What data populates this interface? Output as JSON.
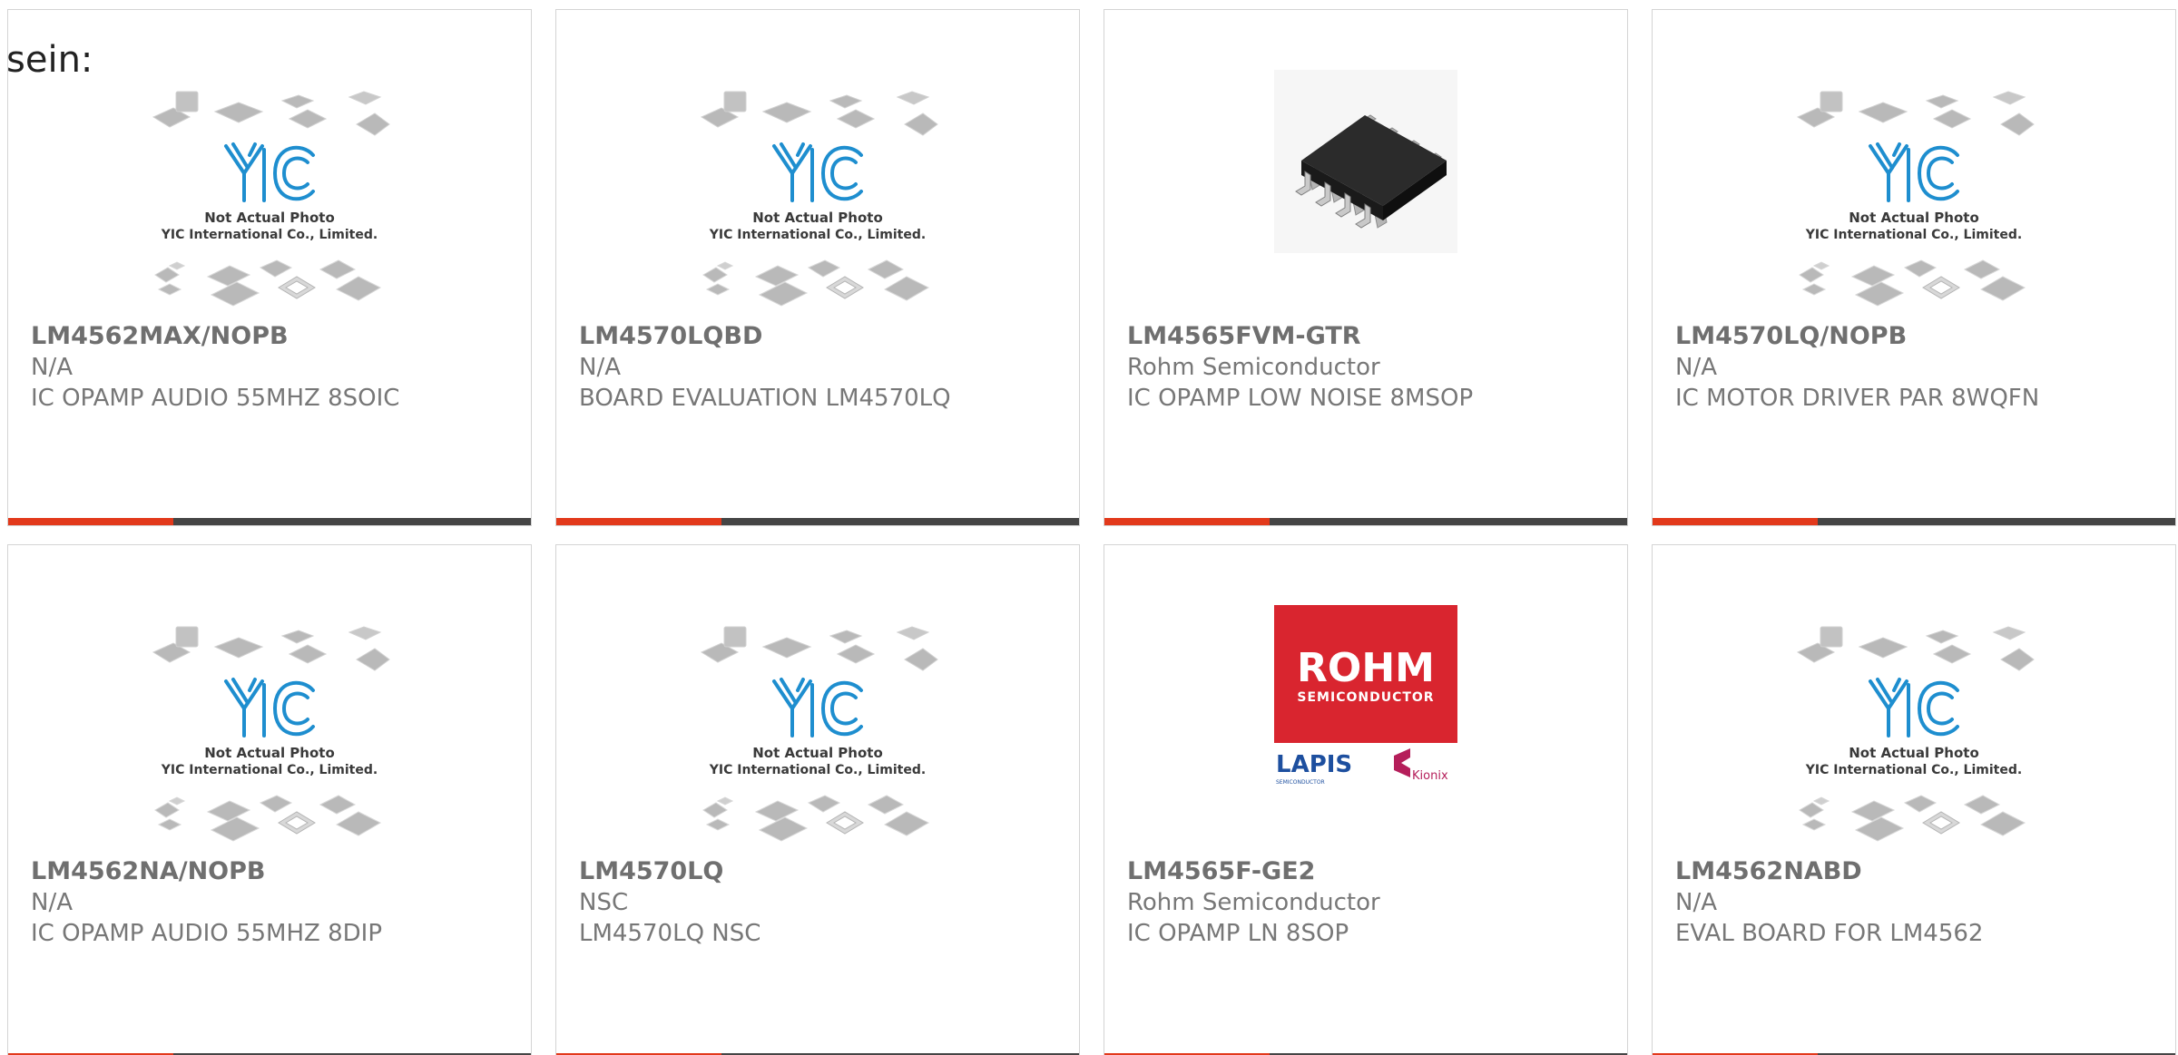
{
  "heading": "sein:",
  "colors": {
    "accent": "#e2391b",
    "bar_dark": "#454545",
    "border": "#d4d4d4",
    "text": "#777777",
    "yic_blue": "#1e8ecf",
    "rohm_red": "#d9252f"
  },
  "placeholder": {
    "line1": "Not Actual Photo",
    "line2": "YIC International Co., Limited.",
    "logo_text": "YIC"
  },
  "rohm_logo": {
    "brand": "ROHM",
    "sub": "SEMICONDUCTOR",
    "lapis": "LAPIS",
    "lapis_sub": "SEMICONDUCTOR",
    "kionix": "Kionix"
  },
  "products": [
    {
      "part": "LM4562MAX/NOPB",
      "manufacturer": "N/A",
      "description": "IC OPAMP AUDIO 55MHZ 8SOIC",
      "image": "placeholder-icon"
    },
    {
      "part": "LM4570LQBD",
      "manufacturer": "N/A",
      "description": "BOARD EVALUATION LM4570LQ",
      "image": "placeholder-icon"
    },
    {
      "part": "LM4565FVM-GTR",
      "manufacturer": "Rohm Semiconductor",
      "description": "IC OPAMP LOW NOISE 8MSOP",
      "image": "chip-icon"
    },
    {
      "part": "LM4570LQ/NOPB",
      "manufacturer": "N/A",
      "description": "IC MOTOR DRIVER PAR 8WQFN",
      "image": "placeholder-icon"
    },
    {
      "part": "LM4562NA/NOPB",
      "manufacturer": "N/A",
      "description": "IC OPAMP AUDIO 55MHZ 8DIP",
      "image": "placeholder-icon"
    },
    {
      "part": "LM4570LQ",
      "manufacturer": "NSC",
      "description": "LM4570LQ NSC",
      "image": "placeholder-icon"
    },
    {
      "part": "LM4565F-GE2",
      "manufacturer": "Rohm Semiconductor",
      "description": "IC OPAMP LN 8SOP",
      "image": "rohm-logo"
    },
    {
      "part": "LM4562NABD",
      "manufacturer": "N/A",
      "description": "EVAL BOARD FOR LM4562",
      "image": "placeholder-icon"
    }
  ]
}
